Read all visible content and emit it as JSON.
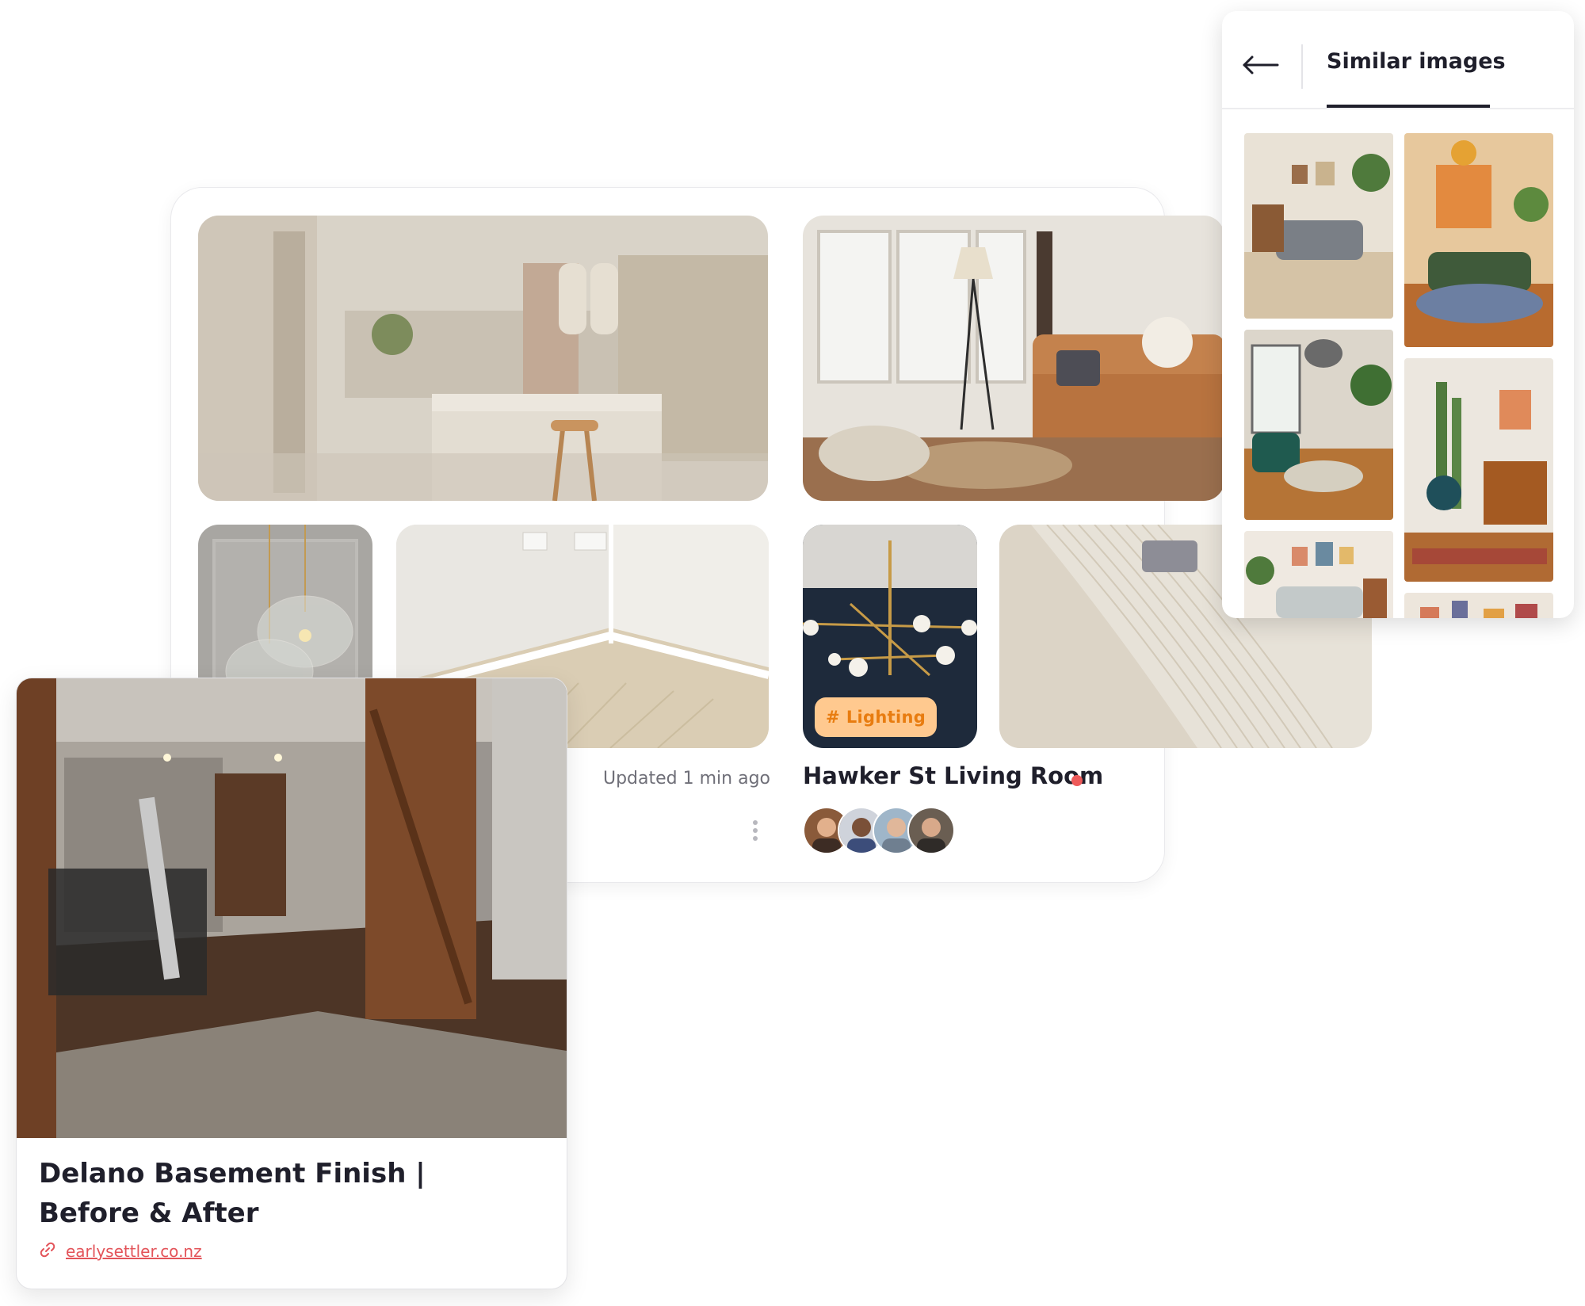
{
  "board": {
    "tag_label": "Lighting",
    "tag_hash": "#",
    "updated": "Updated 1 min ago",
    "title": "Hawker St Living Room",
    "collaborators": [
      "collaborator 1",
      "collaborator 2",
      "collaborator 3",
      "collaborator 4"
    ]
  },
  "pin_card": {
    "title": "Delano Basement Finish | Before & After",
    "link": "earlysettler.co.nz"
  },
  "similar_panel": {
    "title": "Similar images",
    "back_icon": "arrow-left-icon"
  },
  "colors": {
    "accent_tag_bg": "#ffc98f",
    "accent_tag_text": "#e87c10",
    "live_dot": "#ee5a5a",
    "link": "#e3545a"
  }
}
